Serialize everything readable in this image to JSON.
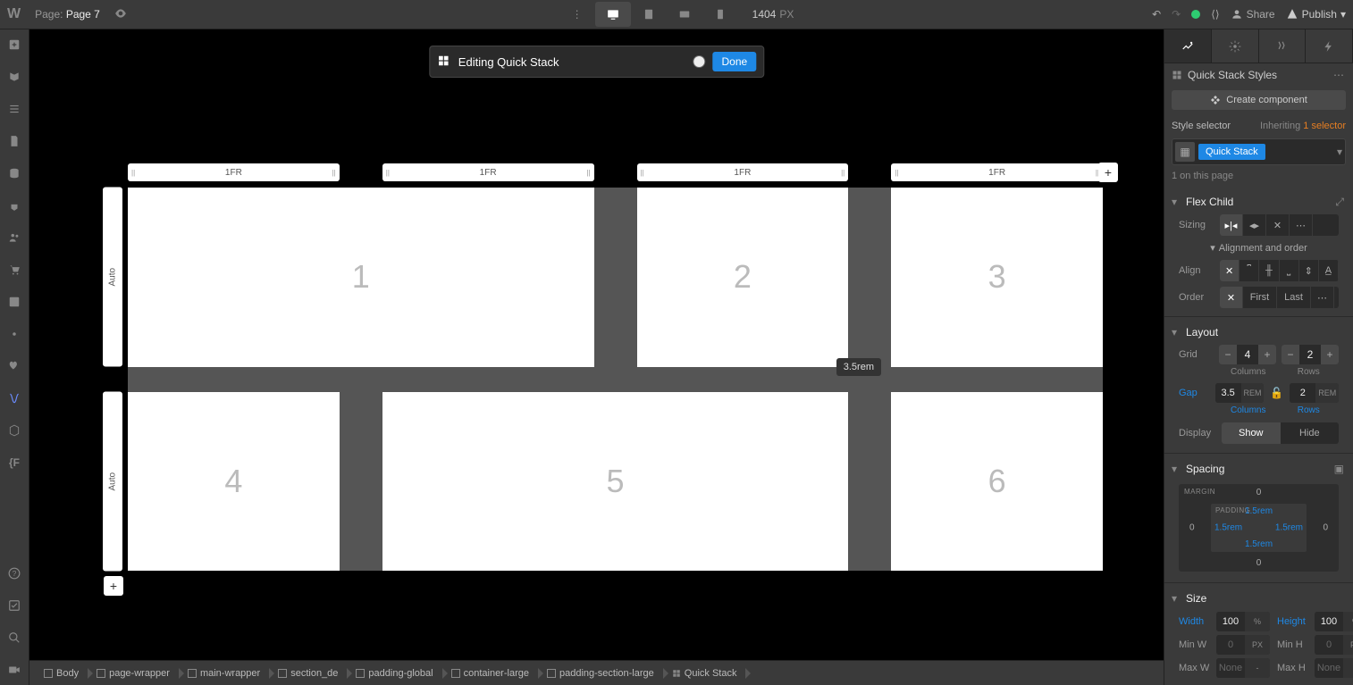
{
  "topbar": {
    "pageLabel": "Page:",
    "pageName": "Page 7",
    "canvasWidth": "1404",
    "canvasUnit": "PX",
    "share": "Share",
    "publish": "Publish"
  },
  "editingBar": {
    "title": "Editing Quick Stack",
    "done": "Done"
  },
  "columns": [
    "1FR",
    "1FR",
    "1FR",
    "1FR"
  ],
  "rows": [
    "Auto",
    "Auto"
  ],
  "cells": [
    "1",
    "2",
    "3",
    "4",
    "5",
    "6"
  ],
  "gapTooltip": "3.5rem",
  "rightPanel": {
    "stylesTitle": "Quick Stack Styles",
    "createComponent": "Create component",
    "styleSelectorLabel": "Style selector",
    "inheriting": "Inheriting",
    "inheritingCount": "1 selector",
    "selectorTag": "Quick Stack",
    "onPage": "1 on this page",
    "flexChild": {
      "title": "Flex Child",
      "sizing": "Sizing",
      "alignmentOrder": "Alignment and order",
      "align": "Align",
      "order": "Order",
      "first": "First",
      "last": "Last"
    },
    "layout": {
      "title": "Layout",
      "grid": "Grid",
      "cols": "4",
      "rows": "2",
      "colsLabel": "Columns",
      "rowsLabel": "Rows",
      "gap": "Gap",
      "gapCol": "3.5",
      "gapColUnit": "REM",
      "gapRow": "2",
      "gapRowUnit": "REM",
      "gapColLabel": "Columns",
      "gapRowLabel": "Rows",
      "display": "Display",
      "show": "Show",
      "hide": "Hide"
    },
    "spacing": {
      "title": "Spacing",
      "margin": "MARGIN",
      "padding": "PADDING",
      "mTop": "0",
      "mRight": "0",
      "mBottom": "0",
      "mLeft": "0",
      "pTop": "1.5rem",
      "pRight": "1.5rem",
      "pBottom": "1.5rem",
      "pLeft": "1.5rem"
    },
    "size": {
      "title": "Size",
      "width": "Width",
      "widthVal": "100",
      "widthUnit": "%",
      "height": "Height",
      "heightVal": "100",
      "heightUnit": "%",
      "minW": "Min W",
      "minWVal": "0",
      "minWUnit": "PX",
      "minH": "Min H",
      "minHVal": "0",
      "minHUnit": "PX",
      "maxW": "Max W",
      "maxWVal": "None",
      "maxWUnit": "-",
      "maxH": "Max H",
      "maxHVal": "None",
      "maxHUnit": "-"
    }
  },
  "breadcrumb": [
    "Body",
    "page-wrapper",
    "main-wrapper",
    "section_de",
    "padding-global",
    "container-large",
    "padding-section-large",
    "Quick Stack"
  ]
}
